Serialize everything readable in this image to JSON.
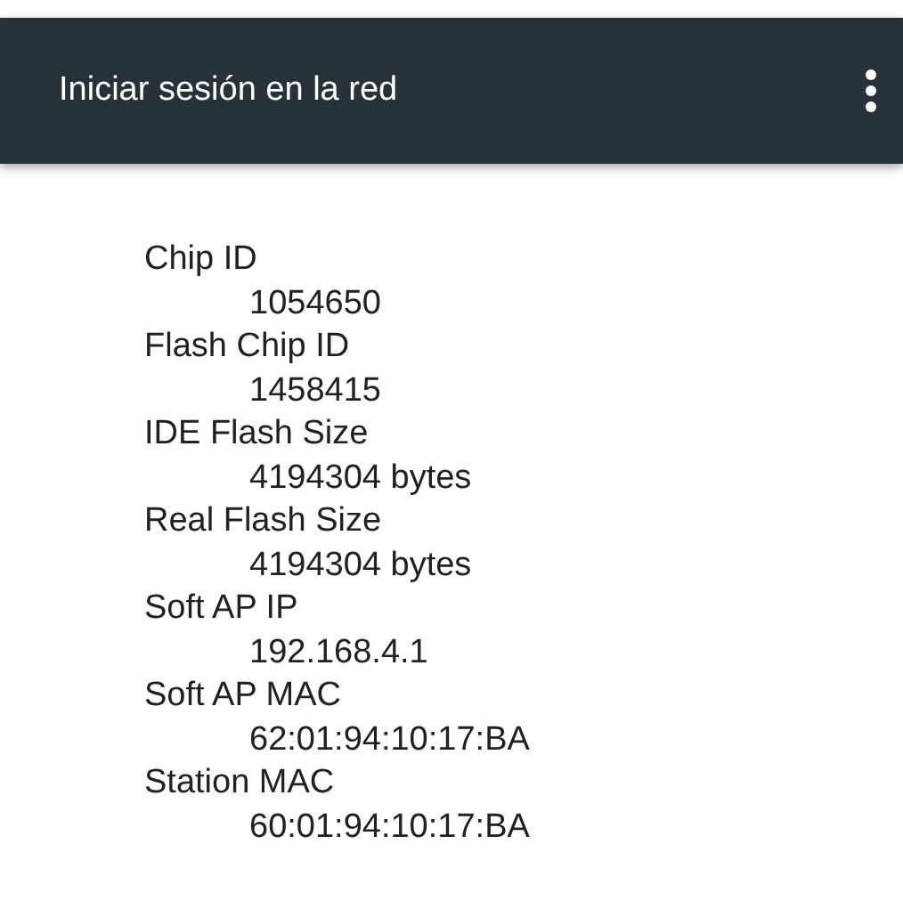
{
  "app_bar": {
    "title": "Iniciar sesión en la red"
  },
  "info": [
    {
      "term": "Chip ID",
      "value": "1054650"
    },
    {
      "term": "Flash Chip ID",
      "value": "1458415"
    },
    {
      "term": "IDE Flash Size",
      "value": "4194304 bytes"
    },
    {
      "term": "Real Flash Size",
      "value": "4194304 bytes"
    },
    {
      "term": "Soft AP IP",
      "value": "192.168.4.1"
    },
    {
      "term": "Soft AP MAC",
      "value": "62:01:94:10:17:BA"
    },
    {
      "term": "Station MAC",
      "value": "60:01:94:10:17:BA"
    }
  ]
}
